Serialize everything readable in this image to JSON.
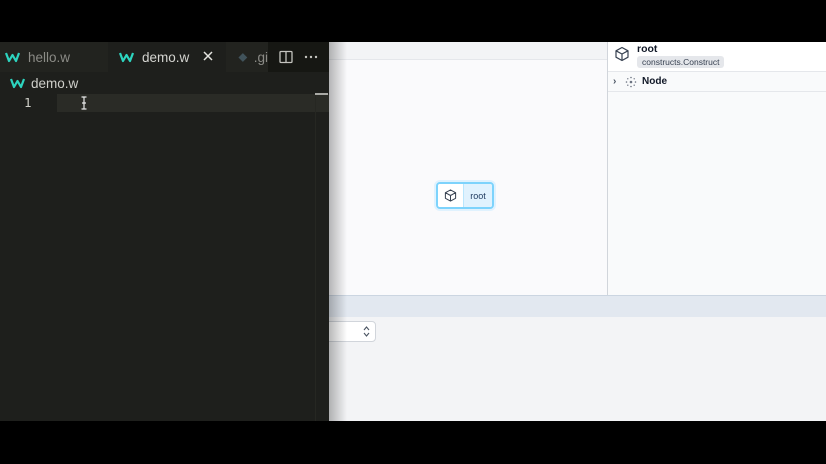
{
  "editor": {
    "tabs": [
      {
        "label": "hello.w",
        "active": false
      },
      {
        "label": "demo.w",
        "active": true
      },
      {
        "label": ".gi",
        "active": false
      }
    ],
    "breadcrumb": "demo.w",
    "line_number": "1",
    "icons": [
      "wing-file-icon",
      "close-icon",
      "split-editor-icon",
      "more-actions-icon",
      "git-file-icon",
      "text-cursor-icon"
    ]
  },
  "app": {
    "graph": {
      "node_label": "root",
      "node_icon": "cube-icon"
    },
    "inspector": {
      "title": "root",
      "type_badge": "constructs.Construct",
      "section": "Node",
      "section_icon": "node-dots-icon"
    },
    "bottom": {
      "selector_value": ""
    }
  },
  "colors": {
    "editor_bg": "#1e1f1c",
    "wing_accent": "#2dd4bf",
    "node_border": "#7dd3fc"
  }
}
